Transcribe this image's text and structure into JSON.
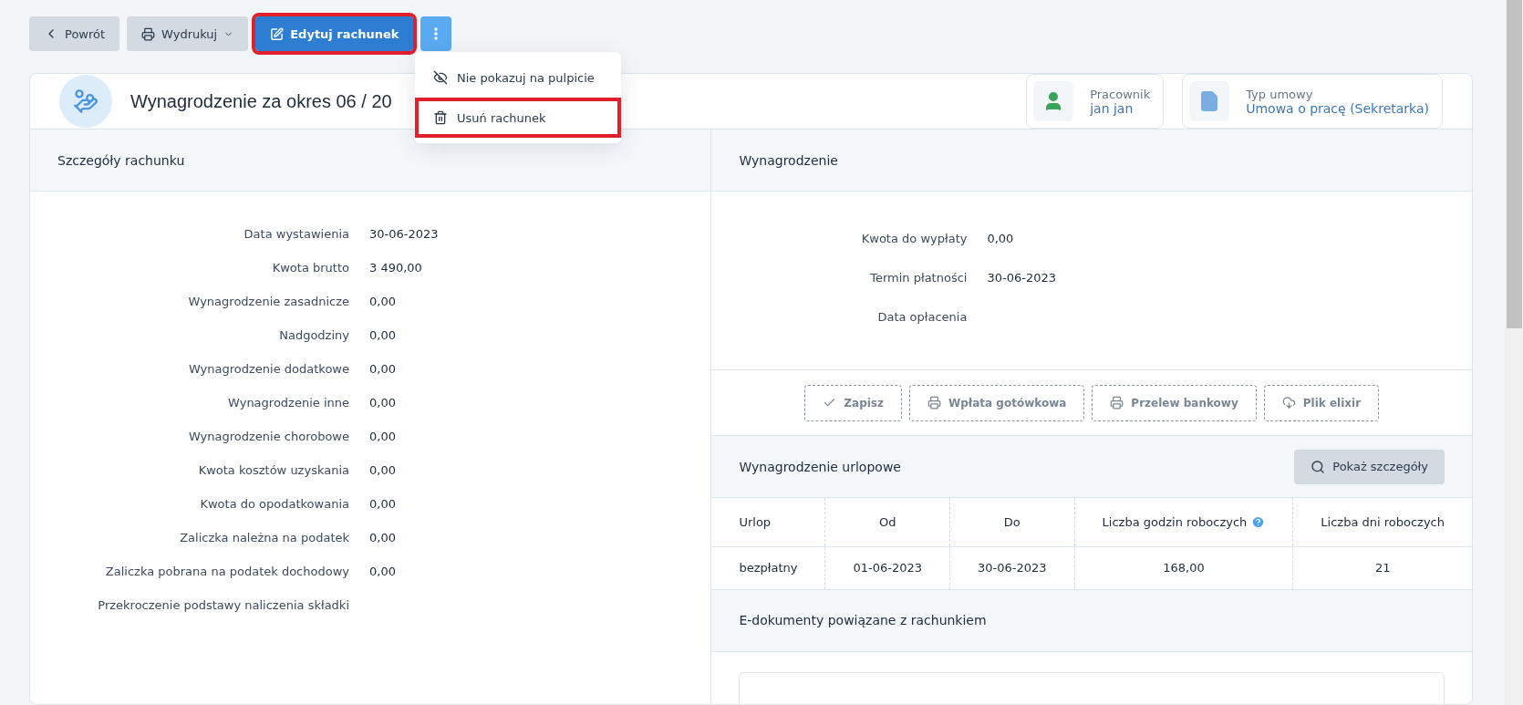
{
  "toolbar": {
    "buttons": [
      {
        "kind": "back",
        "label": "Powrót",
        "highlighted": false
      },
      {
        "kind": "print",
        "label": "Wydrukuj",
        "highlighted": false
      },
      {
        "kind": "edit",
        "label": "Edytuj rachunek",
        "highlighted": true
      },
      {
        "kind": "more",
        "highlighted": false,
        "expanded": true
      }
    ]
  },
  "menu": {
    "items": [
      {
        "kind": "hide",
        "label": "Nie pokazuj na pulpicie",
        "highlighted": false
      },
      {
        "kind": "delete",
        "label": "Usuń rachunek",
        "highlighted": true
      }
    ]
  },
  "header": {
    "title": "Wynagrodzenie za okres 06 / 20",
    "info": [
      {
        "kind": "person",
        "label": "Pracownik",
        "value": "jan jan"
      },
      {
        "kind": "document",
        "label": "Typ umowy",
        "value": "Umowa o pracę (Sekretarka)"
      }
    ]
  },
  "details": {
    "title": "Szczegóły rachunku",
    "rows": [
      {
        "label": "Data wystawienia",
        "value": "30-06-2023"
      },
      {
        "label": "Kwota brutto",
        "value": "3 490,00"
      },
      {
        "label": "Wynagrodzenie zasadnicze",
        "value": "0,00"
      },
      {
        "label": "Nadgodziny",
        "value": "0,00"
      },
      {
        "label": "Wynagrodzenie dodatkowe",
        "value": "0,00"
      },
      {
        "label": "Wynagrodzenie inne",
        "value": "0,00"
      },
      {
        "label": "Wynagrodzenie chorobowe",
        "value": "0,00"
      },
      {
        "label": "Kwota kosztów uzyskania",
        "value": "0,00"
      },
      {
        "label": "Kwota do opodatkowania",
        "value": "0,00"
      },
      {
        "label": "Zaliczka należna na podatek",
        "value": "0,00"
      },
      {
        "label": "Zaliczka pobrana na podatek dochodowy",
        "value": "0,00"
      },
      {
        "label": "Przekroczenie podstawy naliczenia składki"
      }
    ]
  },
  "salary": {
    "title": "Wynagrodzenie",
    "rows": [
      {
        "label": "Kwota do wypłaty",
        "value": "0,00"
      },
      {
        "label": "Termin płatności",
        "value": "30-06-2023"
      },
      {
        "label": "Data opłacenia"
      }
    ],
    "actions": [
      {
        "kind": "check",
        "label": "Zapisz"
      },
      {
        "kind": "print",
        "label": "Wpłata gotówkowa"
      },
      {
        "kind": "print",
        "label": "Przelew bankowy"
      },
      {
        "kind": "cloud",
        "label": "Plik elixir"
      }
    ]
  },
  "vacation": {
    "title": "Wynagrodzenie urlopowe",
    "button": "Pokaż szczegóły",
    "columns": [
      {
        "label": "Urlop",
        "help": false
      },
      {
        "label": "Od",
        "help": false
      },
      {
        "label": "Do",
        "help": false
      },
      {
        "label": "Liczba godzin roboczych",
        "help": true
      },
      {
        "label": "Liczba dni roboczych",
        "help": false
      }
    ],
    "rows": [
      [
        "bezpłatny",
        "01-06-2023",
        "30-06-2023",
        "168,00",
        "21"
      ]
    ]
  },
  "edocs": {
    "title": "E-dokumenty powiązane z rachunkiem"
  }
}
